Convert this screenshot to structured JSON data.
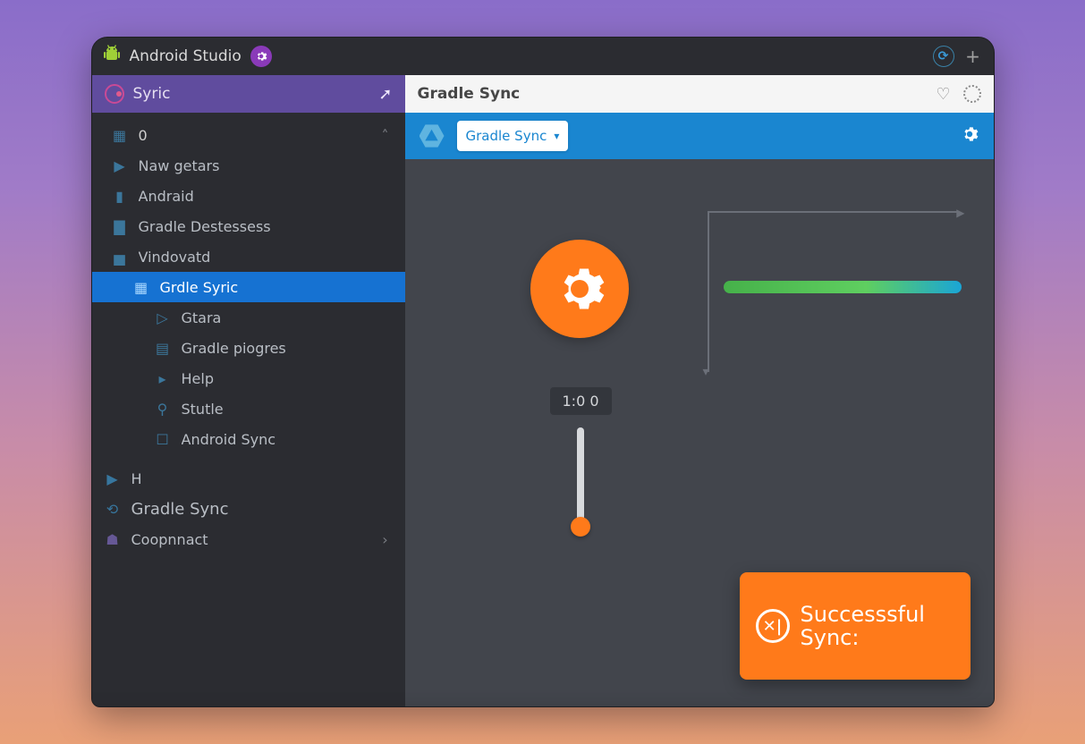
{
  "titlebar": {
    "app_name": "Android Studio"
  },
  "sidebar": {
    "sync_label": "Syric",
    "items": [
      {
        "count": "0"
      },
      {
        "label": "Naw getars"
      },
      {
        "label": "Andraid"
      },
      {
        "label": "Gradle Destessess"
      },
      {
        "label": "Vindovatd"
      },
      {
        "label": "Grdle Syric",
        "selected": true
      },
      {
        "label": "Gtara"
      },
      {
        "label": "Gradle piogres"
      },
      {
        "label": "Help"
      },
      {
        "label": "Stutle"
      },
      {
        "label": "Android Sync"
      }
    ],
    "footer": [
      {
        "label": "H"
      },
      {
        "label": "Gradle Sync"
      },
      {
        "label": "Coopnnact"
      }
    ]
  },
  "panel": {
    "title": "Gradle Sync",
    "dropdown_label": "Gradle Sync"
  },
  "stage": {
    "counter": "1:0 0"
  },
  "toast": {
    "line1": "Successsful",
    "line2": "Sync:"
  }
}
